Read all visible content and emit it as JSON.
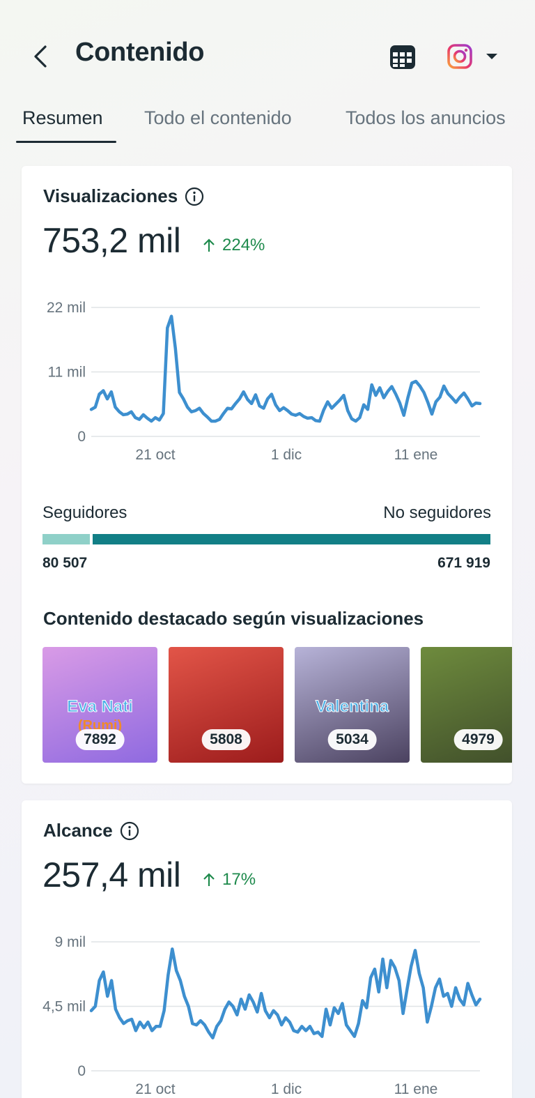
{
  "header": {
    "title": "Contenido",
    "back_icon": "chevron-left-icon",
    "calendar_icon": "calendar-icon",
    "account_icon": "instagram-icon"
  },
  "tabs": [
    {
      "label": "Resumen",
      "active": true
    },
    {
      "label": "Todo el contenido",
      "active": false
    },
    {
      "label": "Todos los anuncios",
      "active": false
    }
  ],
  "views": {
    "title": "Visualizaciones",
    "total": "753,2 mil",
    "delta": "224%",
    "followers_label": "Seguidores",
    "nonfollowers_label": "No seguidores",
    "followers_value": "80 507",
    "nonfollowers_value": "671 919",
    "highlight_title": "Contenido destacado según visualizaciones",
    "thumbnails": [
      {
        "count": "7892",
        "caption": "Eva Nati",
        "caption2": "(Rumi)",
        "colors": [
          "#d99be6",
          "#8f6ae0"
        ]
      },
      {
        "count": "5808",
        "caption": "",
        "caption2": "",
        "colors": [
          "#e25548",
          "#9c1c1c"
        ]
      },
      {
        "count": "5034",
        "caption": "Valentina",
        "caption2": "",
        "colors": [
          "#b7b3d8",
          "#4b4260"
        ]
      },
      {
        "count": "4979",
        "caption": "",
        "caption2": "",
        "colors": [
          "#6e8b3d",
          "#3f4d2a"
        ]
      }
    ]
  },
  "reach": {
    "title": "Alcance",
    "total": "257,4 mil",
    "delta": "17%"
  },
  "colors": {
    "line": "#3d8fcf",
    "positive": "#1e8a4c",
    "followers_bar": "#8fd0c8",
    "nonfollowers_bar": "#127f86"
  },
  "chart_data": [
    {
      "type": "line",
      "ylabel_ticks": [
        "22 mil",
        "11 mil",
        "0"
      ],
      "x_ticks": [
        "21 oct",
        "1 dic",
        "11 ene"
      ],
      "ylim": [
        0,
        22000
      ],
      "series": [
        {
          "values": [
            4600,
            5000,
            7200,
            7800,
            6400,
            7600,
            5000,
            4200,
            3700,
            3800,
            4200,
            3200,
            2900,
            3700,
            3100,
            2600,
            3200,
            2800,
            3900,
            18500,
            20500,
            15000,
            7500,
            6400,
            5000,
            4200,
            4400,
            4800,
            3900,
            3300,
            2600,
            2600,
            2900,
            3900,
            4800,
            4700,
            5600,
            6400,
            7600,
            6300,
            5600,
            7100,
            5200,
            4800,
            6400,
            7200,
            5400,
            4400,
            4900,
            4400,
            3800,
            3600,
            3900,
            3400,
            3100,
            3200,
            2700,
            2600,
            4500,
            5900,
            4800,
            5500,
            6200,
            7000,
            4400,
            3000,
            2600,
            3200,
            5400,
            4600,
            8800,
            7000,
            8300,
            6600,
            7700,
            8500,
            7200,
            5700,
            3600,
            6600,
            9100,
            9400,
            8600,
            7500,
            5800,
            3800,
            5900,
            6700,
            8600,
            7300,
            6600,
            5800,
            6700,
            7400,
            6400,
            5200,
            5700,
            5600
          ]
        }
      ]
    },
    {
      "type": "line",
      "ylabel_ticks": [
        "9 mil",
        "4,5 mil",
        "0"
      ],
      "x_ticks": [
        "21 oct",
        "1 dic",
        "11 ene"
      ],
      "ylim": [
        0,
        9000
      ],
      "series": [
        {
          "values": [
            4200,
            4500,
            6300,
            6900,
            5200,
            6300,
            4300,
            3700,
            3300,
            3500,
            3600,
            2800,
            3400,
            3000,
            3400,
            2800,
            3100,
            3100,
            4200,
            6700,
            8500,
            7000,
            6300,
            5200,
            4500,
            3300,
            3200,
            3500,
            3200,
            2700,
            2300,
            3100,
            3500,
            4300,
            4800,
            4500,
            3900,
            5000,
            4300,
            5300,
            4800,
            4100,
            5400,
            4200,
            3700,
            4200,
            3900,
            3200,
            3700,
            3400,
            2800,
            2700,
            3100,
            2800,
            3100,
            2600,
            2700,
            2400,
            4300,
            3200,
            4400,
            4000,
            4700,
            3200,
            2800,
            2400,
            3300,
            4900,
            4400,
            6500,
            7100,
            5500,
            7800,
            5800,
            7700,
            7200,
            6300,
            4000,
            5700,
            7300,
            8400,
            6800,
            5800,
            3400,
            4500,
            5800,
            6400,
            5200,
            5400,
            4500,
            5800,
            5000,
            4600,
            6100,
            5300,
            4600,
            5000
          ]
        }
      ]
    }
  ]
}
